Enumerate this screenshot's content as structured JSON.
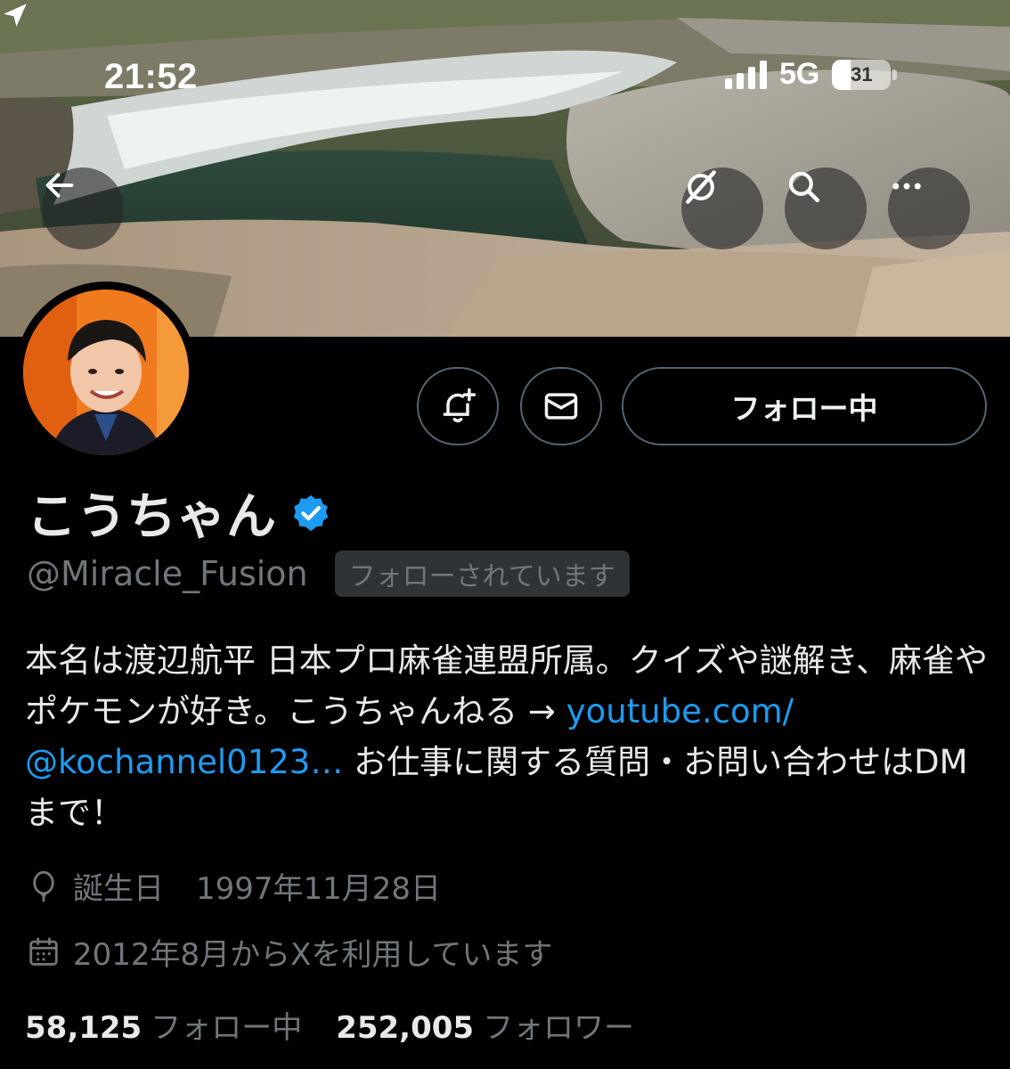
{
  "colors": {
    "background": "#000000",
    "text_primary": "#e7e9ea",
    "text_secondary": "#71767b",
    "link": "#1d9bf0",
    "verified": "#1d9bf0",
    "button_border": "#536471"
  },
  "status_bar": {
    "time": "21:52",
    "network": "5G",
    "battery": "31",
    "battery_level": 0.31,
    "signal_bars": 4
  },
  "header": {
    "back_icon": "arrow-left-icon",
    "icons": [
      "grok-icon",
      "search-icon",
      "more-icon"
    ]
  },
  "profile": {
    "display_name": "こうちゃん",
    "verified": true,
    "handle": "@Miracle_Fusion",
    "follows_you_label": "フォローされています",
    "actions": {
      "notify_icon": "bell-plus-icon",
      "message_icon": "mail-icon",
      "follow_label": "フォロー中"
    },
    "bio": {
      "text_1": "本名は渡辺航平 日本プロ麻雀連盟所属。クイズや謎解き、麻雀やポケモンが好き。こうちゃんねる → ",
      "link_1": "youtube.com/",
      "link_2": "@kochannel0123…",
      "text_2": " お仕事に関する質問・お問い合わせはDMまで！"
    },
    "birthday_label": "誕生日",
    "birthday_value": "1997年11月28日",
    "joined": "2012年8月からXを利用しています",
    "stats": {
      "following_count": "58,125",
      "following_label": "フォロー中",
      "followers_count": "252,005",
      "followers_label": "フォロワー"
    }
  }
}
